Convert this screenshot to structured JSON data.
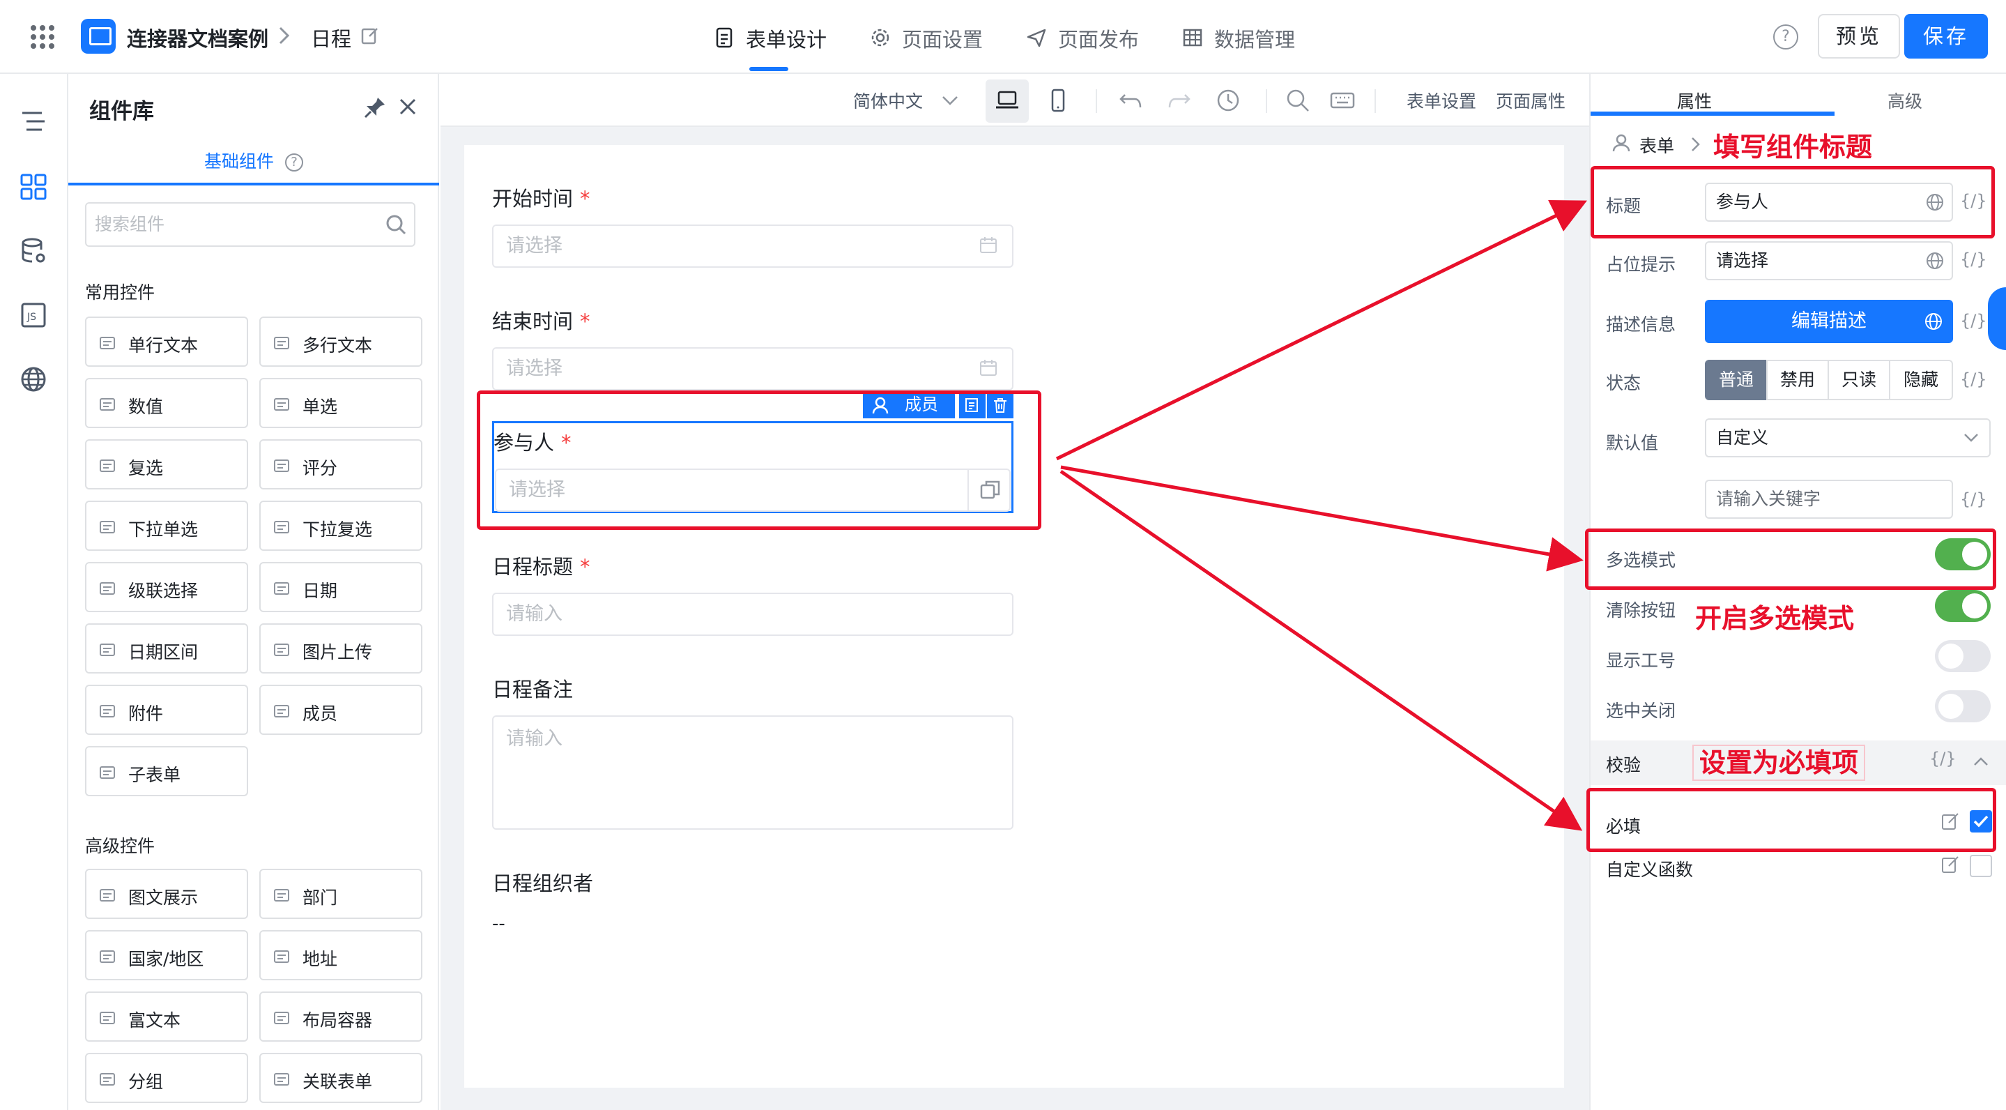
{
  "header": {
    "app_name": "连接器文档案例",
    "breadcrumb_sep": ">",
    "page_name": "日程",
    "tabs": [
      {
        "label": "表单设计",
        "icon": "document-icon"
      },
      {
        "label": "页面设置",
        "icon": "gear-icon"
      },
      {
        "label": "页面发布",
        "icon": "send-icon"
      },
      {
        "label": "数据管理",
        "icon": "table-icon"
      }
    ],
    "help_label": "?",
    "preview_label": "预览",
    "save_label": "保存"
  },
  "library": {
    "title": "组件库",
    "tab_label": "基础组件",
    "search_placeholder": "搜索组件",
    "common_title": "常用控件",
    "common": [
      {
        "label": "单行文本",
        "icon": "single-line-icon"
      },
      {
        "label": "多行文本",
        "icon": "multi-line-icon"
      },
      {
        "label": "数值",
        "icon": "number-icon"
      },
      {
        "label": "单选",
        "icon": "radio-icon"
      },
      {
        "label": "复选",
        "icon": "checkbox-icon"
      },
      {
        "label": "评分",
        "icon": "star-icon"
      },
      {
        "label": "下拉单选",
        "icon": "dropdown-icon"
      },
      {
        "label": "下拉复选",
        "icon": "dropdown-multi-icon"
      },
      {
        "label": "级联选择",
        "icon": "cascade-icon"
      },
      {
        "label": "日期",
        "icon": "calendar-icon"
      },
      {
        "label": "日期区间",
        "icon": "date-range-icon"
      },
      {
        "label": "图片上传",
        "icon": "image-icon"
      },
      {
        "label": "附件",
        "icon": "paperclip-icon"
      },
      {
        "label": "成员",
        "icon": "user-icon"
      },
      {
        "label": "子表单",
        "icon": "subform-icon"
      }
    ],
    "advanced_title": "高级控件",
    "advanced": [
      {
        "label": "图文展示",
        "icon": "rich-display-icon"
      },
      {
        "label": "部门",
        "icon": "department-icon"
      },
      {
        "label": "国家/地区",
        "icon": "globe-icon"
      },
      {
        "label": "地址",
        "icon": "map-icon"
      },
      {
        "label": "富文本",
        "icon": "richtext-icon"
      },
      {
        "label": "布局容器",
        "icon": "layout-icon"
      },
      {
        "label": "分组",
        "icon": "group-icon"
      },
      {
        "label": "关联表单",
        "icon": "link-form-icon"
      }
    ]
  },
  "toolbar": {
    "language": "简体中文",
    "form_settings": "表单设置",
    "page_props": "页面属性"
  },
  "form": {
    "fields": [
      {
        "label": "开始时间",
        "required": true,
        "placeholder": "请选择",
        "type": "date"
      },
      {
        "label": "结束时间",
        "required": true,
        "placeholder": "请选择",
        "type": "date"
      },
      {
        "label": "参与人",
        "required": true,
        "placeholder": "请选择",
        "type": "member"
      },
      {
        "label": "日程标题",
        "required": true,
        "placeholder": "请输入",
        "type": "text"
      },
      {
        "label": "日程备注",
        "required": false,
        "placeholder": "请输入",
        "type": "textarea"
      },
      {
        "label": "日程组织者",
        "required": false,
        "value": "--",
        "type": "readonly"
      }
    ],
    "required_mark": "*",
    "selected_badge": "成员"
  },
  "props": {
    "tabs": [
      "属性",
      "高级"
    ],
    "breadcrumb": "表单",
    "breadcrumb_sep": ">",
    "title_label": "标题",
    "title_value": "参与人",
    "placeholder_label": "占位提示",
    "placeholder_value": "请选择",
    "desc_label": "描述信息",
    "desc_button": "编辑描述",
    "state_label": "状态",
    "states": [
      "普通",
      "禁用",
      "只读",
      "隐藏"
    ],
    "default_label": "默认值",
    "default_value": "自定义",
    "keyword_placeholder": "请输入关键字",
    "expr": "{/}",
    "multi_label": "多选模式",
    "multi_on": true,
    "clear_label": "清除按钮",
    "clear_on": true,
    "show_id_label": "显示工号",
    "show_id_on": false,
    "close_label": "选中关闭",
    "close_on": false,
    "validate_label": "校验",
    "required_label": "必填",
    "required_checked": true,
    "custom_fn_label": "自定义函数",
    "custom_fn_checked": false
  },
  "annotations": {
    "fill_title": "填写组件标题",
    "enable_multi": "开启多选模式",
    "set_required": "设置为必填项"
  },
  "colors": {
    "accent": "#1677ff",
    "annotation": "#e8102b",
    "toggle_on": "#52b04e"
  }
}
